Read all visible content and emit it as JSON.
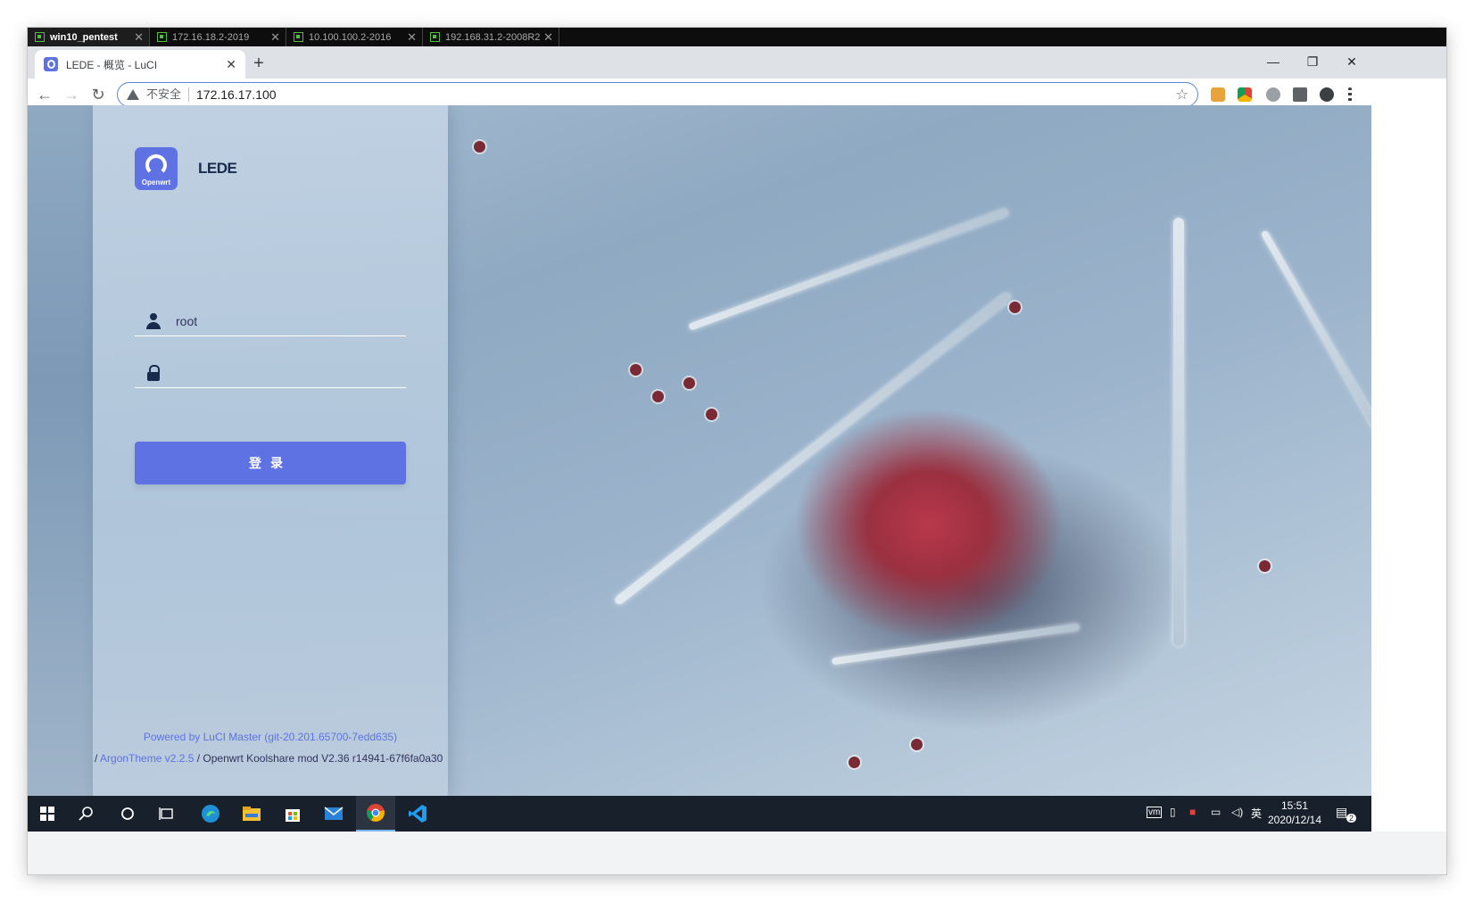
{
  "rdp_tabs": [
    {
      "label": "win10_pentest",
      "active": true
    },
    {
      "label": "172.16.18.2-2019",
      "active": false
    },
    {
      "label": "10.100.100.2-2016",
      "active": false
    },
    {
      "label": "192.168.31.2-2008R2",
      "active": false
    }
  ],
  "browser": {
    "tab_title": "LEDE - 概览 - LuCI",
    "insecure_label": "不安全",
    "url": "172.16.17.100",
    "close_glyph": "✕",
    "new_tab_glyph": "+"
  },
  "window_controls": {
    "minimize": "—",
    "restore": "❐",
    "close": "✕"
  },
  "nav": {
    "back": "←",
    "forward": "→",
    "reload": "↻"
  },
  "login": {
    "logo_caption": "Openwrt",
    "brand": "LEDE",
    "username_value": "root",
    "password_value": "",
    "submit_label": "登录"
  },
  "footer": {
    "line1": "Powered by LuCI Master (git-20.201.65700-7edd635)",
    "line2_prefix": "/ ",
    "theme_link": "ArgonTheme v2.2.5",
    "line2_suffix": " / Openwrt Koolshare mod V2.36 r14941-67f6fa0a30"
  },
  "taskbar": {
    "ime": "英",
    "time": "15:51",
    "date": "2020/12/14",
    "notification_count": "2"
  },
  "colors": {
    "accent": "#5e72e4",
    "heading": "#172b4d",
    "taskbar": "#17202b"
  },
  "icons": [
    "shield-icon",
    "warning-icon",
    "star-icon",
    "user-icon",
    "lock-icon",
    "windows-start-icon",
    "search-icon",
    "cortana-icon",
    "task-view-icon",
    "edge-icon",
    "file-explorer-icon",
    "store-icon",
    "mail-icon",
    "chrome-icon",
    "vscode-icon"
  ]
}
